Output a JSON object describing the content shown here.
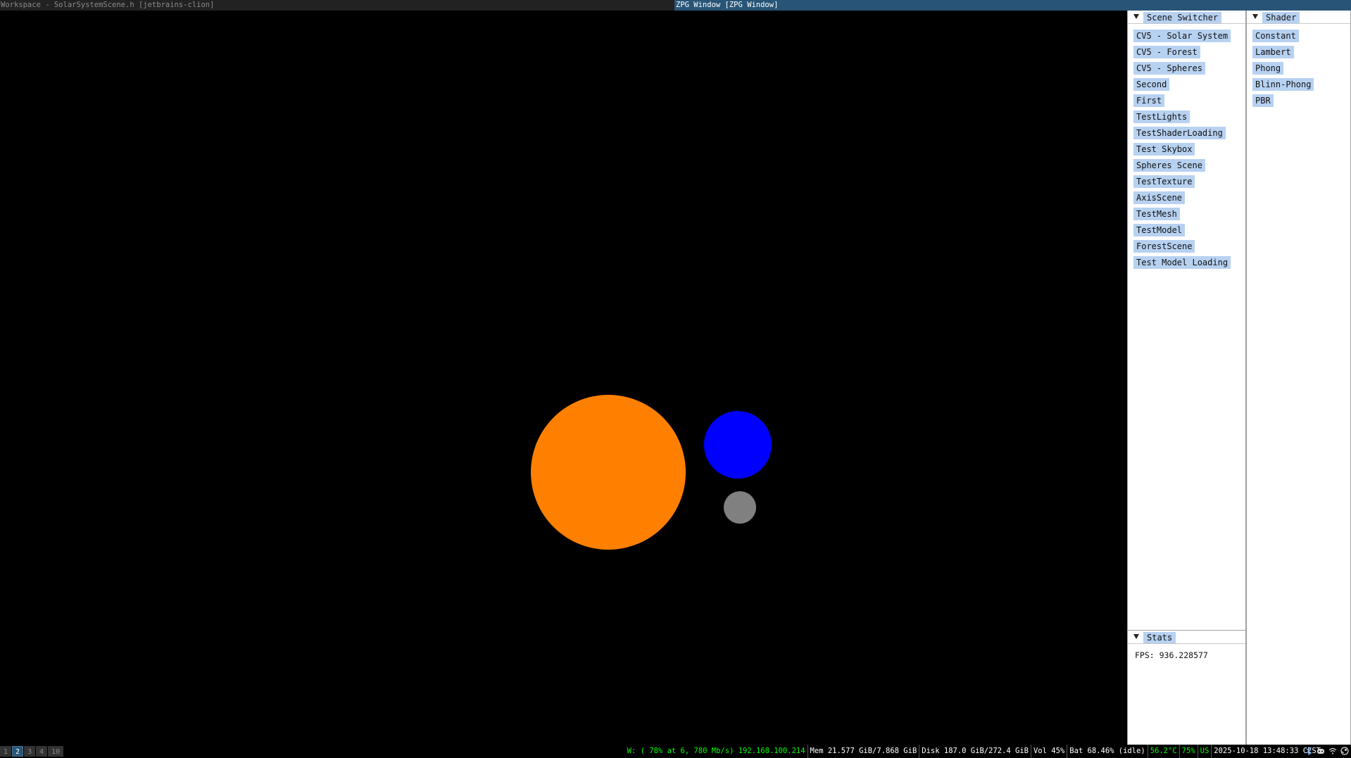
{
  "topbar": {
    "left_title": "Workspace - SolarSystemScene.h [jetbrains-clion]",
    "focused_title": "ZPG Window [ZPG Window]"
  },
  "scene": {
    "background": "#000000",
    "bodies": [
      {
        "name": "sun",
        "color": "#ff8000"
      },
      {
        "name": "earth",
        "color": "#0000ff"
      },
      {
        "name": "moon",
        "color": "#808080"
      }
    ]
  },
  "scene_switcher": {
    "title": "Scene Switcher",
    "items": [
      "CV5 - Solar System",
      "CV5 - Forest",
      "CV5 - Spheres",
      "Second",
      "First",
      "TestLights",
      "TestShaderLoading",
      "Test Skybox",
      "Spheres Scene",
      "TestTexture",
      "AxisScene",
      "TestMesh",
      "TestModel",
      "ForestScene",
      "Test Model Loading"
    ]
  },
  "shader": {
    "title": "Shader",
    "items": [
      "Constant",
      "Lambert",
      "Phong",
      "Blinn-Phong",
      "PBR"
    ]
  },
  "stats": {
    "title": "Stats",
    "fps": "FPS: 936.228577"
  },
  "bottombar": {
    "workspaces": [
      "1",
      "2",
      "3",
      "4",
      "10"
    ],
    "active_workspace": "2",
    "status": [
      {
        "text": "W: ( 78% at 6, 780 Mb/s) 192.168.100.214",
        "color": "#00ff00"
      },
      {
        "text": "Mem 21.577 GiB/7.868 GiB",
        "color": "#ffffff"
      },
      {
        "text": "Disk 187.0 GiB/272.4 GiB",
        "color": "#ffffff"
      },
      {
        "text": "Vol 45%",
        "color": "#ffffff"
      },
      {
        "text": "Bat 68.46% (idle)",
        "color": "#ffffff"
      },
      {
        "text": "56.2°C",
        "color": "#00ff00"
      },
      {
        "text": "75%",
        "color": "#00ff00"
      },
      {
        "text": "US",
        "color": "#00ff00"
      },
      {
        "text": "2025-10-18 13:48:33 CEST",
        "color": "#ffffff"
      }
    ],
    "tray_icons": [
      "bluetooth-icon",
      "discord-icon",
      "wifi-icon",
      "steam-icon"
    ]
  }
}
